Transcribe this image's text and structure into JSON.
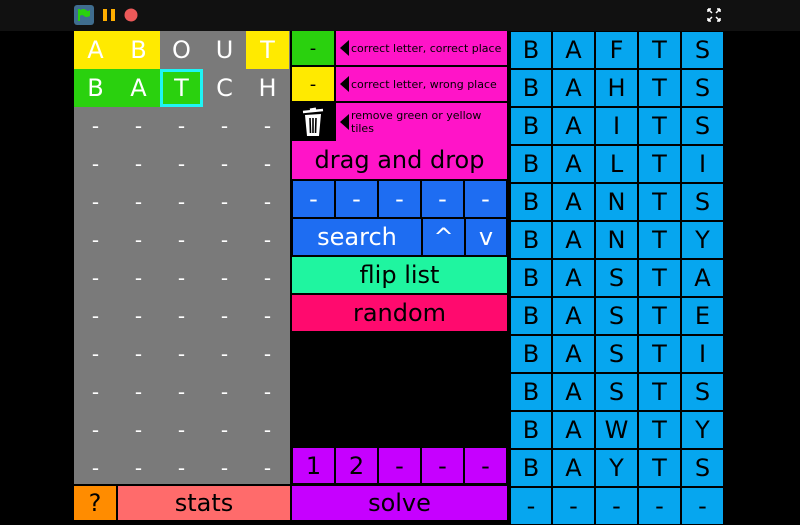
{
  "toolbar": {
    "flag_icon": "green-flag-icon",
    "pause_icon": "pause-icon",
    "stop_icon": "stop-icon",
    "fullscreen_icon": "fullscreen-icon"
  },
  "guesses": [
    [
      "A",
      "B",
      "O",
      "U",
      "T"
    ],
    [
      "B",
      "A",
      "T",
      "C",
      "H"
    ],
    [
      "-",
      "-",
      "-",
      "-",
      "-"
    ],
    [
      "-",
      "-",
      "-",
      "-",
      "-"
    ],
    [
      "-",
      "-",
      "-",
      "-",
      "-"
    ],
    [
      "-",
      "-",
      "-",
      "-",
      "-"
    ],
    [
      "-",
      "-",
      "-",
      "-",
      "-"
    ],
    [
      "-",
      "-",
      "-",
      "-",
      "-"
    ],
    [
      "-",
      "-",
      "-",
      "-",
      "-"
    ],
    [
      "-",
      "-",
      "-",
      "-",
      "-"
    ],
    [
      "-",
      "-",
      "-",
      "-",
      "-"
    ],
    [
      "-",
      "-",
      "-",
      "-",
      "-"
    ]
  ],
  "colors": {
    "yellow": "#ffea00",
    "green": "#2ad10e",
    "pink": "#ff14c8",
    "blue": "#1e6df2",
    "teal": "#1ff5a0",
    "red": "#ff0a6e",
    "purple": "#c600ff",
    "cyan": "#06a6ef",
    "gray": "#7a7a7a",
    "orange": "#ff8c00",
    "salmon": "#ff6b6b"
  },
  "legend": {
    "green_key": "-",
    "yellow_key": "-",
    "green_text": "correct letter, correct place",
    "yellow_text": "correct letter, wrong place",
    "trash_text": "remove green or yellow tiles"
  },
  "buttons": {
    "drag_drop": "drag and drop",
    "search": "search",
    "up": "^",
    "down": "v",
    "flip_list": "flip list",
    "random": "random",
    "stats": "stats",
    "help": "?",
    "solve": "solve"
  },
  "search_slots": [
    "-",
    "-",
    "-",
    "-",
    "-"
  ],
  "bottom_slots": [
    "1",
    "2",
    "-",
    "-",
    "-"
  ],
  "word_list": [
    [
      "B",
      "A",
      "F",
      "T",
      "S"
    ],
    [
      "B",
      "A",
      "H",
      "T",
      "S"
    ],
    [
      "B",
      "A",
      "I",
      "T",
      "S"
    ],
    [
      "B",
      "A",
      "L",
      "T",
      "I"
    ],
    [
      "B",
      "A",
      "N",
      "T",
      "S"
    ],
    [
      "B",
      "A",
      "N",
      "T",
      "Y"
    ],
    [
      "B",
      "A",
      "S",
      "T",
      "A"
    ],
    [
      "B",
      "A",
      "S",
      "T",
      "E"
    ],
    [
      "B",
      "A",
      "S",
      "T",
      "I"
    ],
    [
      "B",
      "A",
      "S",
      "T",
      "S"
    ],
    [
      "B",
      "A",
      "W",
      "T",
      "Y"
    ],
    [
      "B",
      "A",
      "Y",
      "T",
      "S"
    ],
    [
      "-",
      "-",
      "-",
      "-",
      "-"
    ]
  ]
}
